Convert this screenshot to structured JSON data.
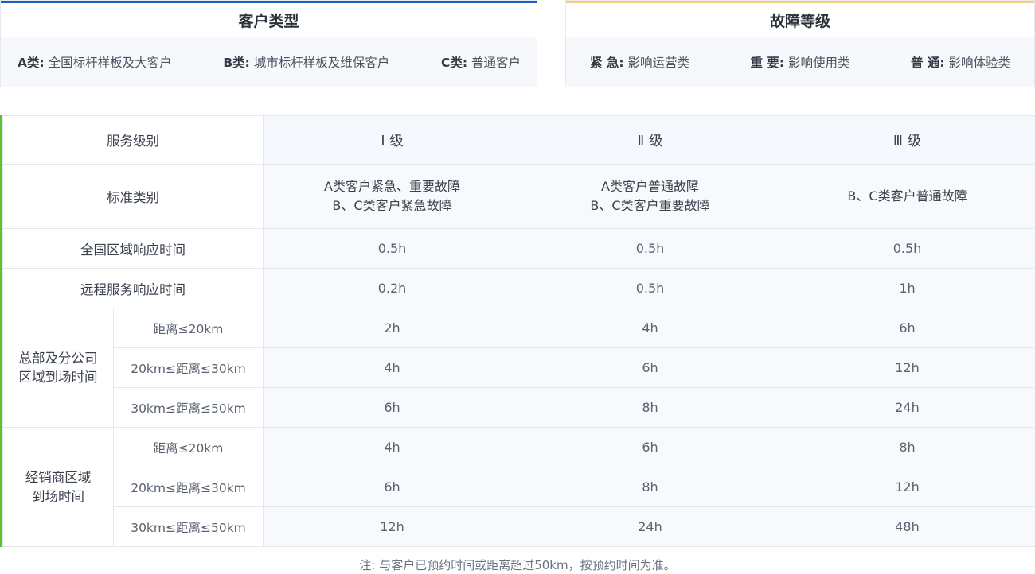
{
  "customer_types": {
    "title": "客户类型",
    "items": [
      {
        "key": "A类:",
        "desc": "全国标杆样板及大客户"
      },
      {
        "key": "B类:",
        "desc": "城市标杆样板及维保客户"
      },
      {
        "key": "C类:",
        "desc": "普通客户"
      }
    ]
  },
  "fault_levels": {
    "title": "故障等级",
    "items": [
      {
        "key": "紧 急:",
        "desc": "影响运营类"
      },
      {
        "key": "重 要:",
        "desc": "影响使用类"
      },
      {
        "key": "普 通:",
        "desc": "影响体验类"
      }
    ]
  },
  "sla_table": {
    "header": {
      "label": "服务级别",
      "levels": [
        "Ⅰ 级",
        "Ⅱ 级",
        "Ⅲ 级"
      ]
    },
    "standard": {
      "label": "标准类别",
      "cells": [
        [
          "A类客户紧急、重要故障",
          "B、C类客户紧急故障"
        ],
        [
          "A类客户普通故障",
          "B、C类客户重要故障"
        ],
        [
          "B、C类客户普通故障"
        ]
      ]
    },
    "national_response": {
      "label": "全国区域响应时间",
      "values": [
        "0.5h",
        "0.5h",
        "0.5h"
      ]
    },
    "remote_response": {
      "label": "远程服务响应时间",
      "values": [
        "0.2h",
        "0.5h",
        "1h"
      ]
    },
    "hq_group": {
      "label_lines": [
        "总部及分公司",
        "区域到场时间"
      ],
      "rows": [
        {
          "distance": "距离≤20km",
          "values": [
            "2h",
            "4h",
            "6h"
          ]
        },
        {
          "distance": "20km≤距离≤30km",
          "values": [
            "4h",
            "6h",
            "12h"
          ]
        },
        {
          "distance": "30km≤距离≤50km",
          "values": [
            "6h",
            "8h",
            "24h"
          ]
        }
      ]
    },
    "dealer_group": {
      "label_lines": [
        "经销商区域",
        "到场时间"
      ],
      "rows": [
        {
          "distance": "距离≤20km",
          "values": [
            "4h",
            "6h",
            "8h"
          ]
        },
        {
          "distance": "20km≤距离≤30km",
          "values": [
            "6h",
            "8h",
            "12h"
          ]
        },
        {
          "distance": "30km≤距离≤50km",
          "values": [
            "12h",
            "24h",
            "48h"
          ]
        }
      ]
    }
  },
  "note": "注: 与客户已预约时间或距离超过50km，按预约时间为准。",
  "colors": {
    "customer_bar": "#1f5fbf",
    "fault_bar": "#f5cf7a",
    "table_accent": "#5ec12d"
  }
}
